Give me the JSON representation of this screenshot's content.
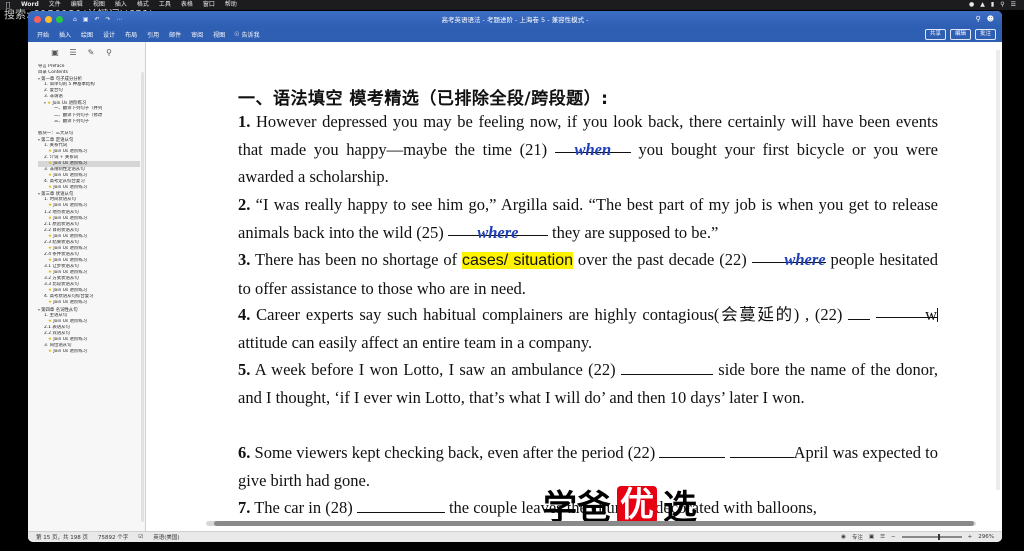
{
  "overlay_text": "搜索: 0150121(关键词)(651)",
  "menubar": {
    "app": "Word",
    "items": [
      "文件",
      "编辑",
      "视图",
      "插入",
      "格式",
      "工具",
      "表格",
      "窗口",
      "帮助"
    ]
  },
  "window": {
    "title": "高考英语语法 - 考题进阶 - 上海卷 5 - 兼容性模式 -",
    "share_label": "共享",
    "edit_label": "编辑",
    "comment_label": "批注"
  },
  "ribbon": {
    "tabs": [
      "开始",
      "插入",
      "绘图",
      "设计",
      "布局",
      "引用",
      "邮件",
      "审阅",
      "视图"
    ],
    "tell_me": "告诉我"
  },
  "nav": {
    "items": [
      {
        "text": "导言 Preface",
        "level": 1
      },
      {
        "text": "目录 Contents",
        "level": 1
      },
      {
        "text": "第一章  句子成分分析",
        "level": 1,
        "tri": true
      },
      {
        "text": "1. 简单句的 5 种基本结构",
        "level": 2
      },
      {
        "text": "2. 复合句",
        "level": 2
      },
      {
        "text": "3. 非谓语",
        "level": 2
      },
      {
        "text": "Join Us 进阶练习",
        "level": 2,
        "star": true,
        "tri": true
      },
      {
        "text": "一、翻译下列句子（并列",
        "level": 4
      },
      {
        "text": "二、翻译下列句子（修改",
        "level": 4
      },
      {
        "text": "三、翻译下列句子",
        "level": 4
      },
      {
        "text": "",
        "level": 1
      },
      {
        "text": "板块一：三大从句",
        "level": 1
      },
      {
        "text": "第二章  定语从句",
        "level": 1,
        "tri": true
      },
      {
        "text": "1. 关系代词",
        "level": 2
      },
      {
        "text": "Join Us 进阶练习",
        "level": 3,
        "star": true
      },
      {
        "text": "2. 介词 + 关系词",
        "level": 2
      },
      {
        "text": "Join Us 进阶练习",
        "level": 3,
        "star": true,
        "sel": true
      },
      {
        "text": "3. 非限制性定语从句",
        "level": 2
      },
      {
        "text": "Join Us 进阶练习",
        "level": 3,
        "star": true
      },
      {
        "text": "4. 高考定从综合复习",
        "level": 2
      },
      {
        "text": "Join Us 进阶练习",
        "level": 3,
        "star": true
      },
      {
        "text": "第三章  状语从句",
        "level": 1,
        "tri": true
      },
      {
        "text": "1. 时间状语从句",
        "level": 2
      },
      {
        "text": "Join Us 进阶练习",
        "level": 3,
        "star": true
      },
      {
        "text": "1.2 地点状语从句",
        "level": 2
      },
      {
        "text": "Join Us 进阶练习",
        "level": 3,
        "star": true
      },
      {
        "text": "2.1 原因状语从句",
        "level": 2
      },
      {
        "text": "2.2 目的状语从句",
        "level": 2
      },
      {
        "text": "Join Us 进阶练习",
        "level": 3,
        "star": true
      },
      {
        "text": "2.3 结果状语从句",
        "level": 2
      },
      {
        "text": "Join Us 进阶练习",
        "level": 3,
        "star": true
      },
      {
        "text": "2.4 条件状语从句",
        "level": 2
      },
      {
        "text": "Join Us 进阶练习",
        "level": 3,
        "star": true
      },
      {
        "text": "3.1 让步状语从句",
        "level": 2
      },
      {
        "text": "Join Us 进阶练习",
        "level": 3,
        "star": true
      },
      {
        "text": "3.2 方式状语从句",
        "level": 2
      },
      {
        "text": "3.3 比较状语从句",
        "level": 2
      },
      {
        "text": "Join Us 进阶练习",
        "level": 3,
        "star": true
      },
      {
        "text": "4. 高考状语从句综合复习",
        "level": 2
      },
      {
        "text": "Join Us 进阶练习",
        "level": 3,
        "star": true
      },
      {
        "text": "第四章  名词性从句",
        "level": 1,
        "tri": true
      },
      {
        "text": "1. 主语从句",
        "level": 2
      },
      {
        "text": "Join Us 进阶练习",
        "level": 3,
        "star": true
      },
      {
        "text": "2.1 表语从句",
        "level": 2
      },
      {
        "text": "2.2 宾语从句",
        "level": 2
      },
      {
        "text": "Join Us 进阶练习",
        "level": 3,
        "star": true
      },
      {
        "text": "3. 同位语从句",
        "level": 2
      },
      {
        "text": "Join Us 进阶练习",
        "level": 3,
        "star": true
      }
    ]
  },
  "doc": {
    "heading": "一、语法填空  模考精选（已排除全段/跨段题）:",
    "p1": {
      "num": "1.",
      "a": " However depressed you may be feeling now, if you look back, there certainly will have been events that made you happy—maybe the time (21) ",
      "ans": "when",
      "b": " you bought your first bicycle or you were awarded a scholarship."
    },
    "p2": {
      "num": "2.",
      "a": " “I was really happy to see him go,” Argilla said. “The best part of my job is when you get to release animals back into the wild (25) ",
      "ans": "where",
      "b": " they are supposed to be.”"
    },
    "p3": {
      "num": "3.",
      "a": " There has been no shortage of ",
      "hl": "cases/ situation",
      "b": " over the past decade (22) ",
      "ans": "where",
      "c": " people hesitated to offer assistance to those who are in need."
    },
    "p4": {
      "num": "4.",
      "a": " Career experts say such habitual complainers are highly contagious(会蔓延的) , (22) ",
      "typed": "w",
      "b": " attitude can easily affect an entire team in a company."
    },
    "p5": {
      "num": "5.",
      "a": " A week before I won Lotto, I saw an ambulance (22) ",
      "b": " side bore the name of the donor, and I thought, ‘if I ever win Lotto, that’s what I will do’ and then 10 days’ later I won."
    },
    "p6": {
      "num": "6.",
      "a": " Some viewers kept checking back, even after the period (22) ",
      "b": "April was expected to give birth had gone."
    },
    "p7": {
      "num": "7.",
      "a": " The car in (28) ",
      "b": " the couple leaves the church is decorated with balloons,"
    },
    "watermark": {
      "a": "学爸",
      "b": "优",
      "c": "选"
    }
  },
  "status": {
    "page": "第 15 页，共 198 页",
    "words": "75892 个字",
    "lang": "英语(美国)",
    "focus": "专注",
    "zoom": "296%",
    "zoom_level": 0.62
  }
}
